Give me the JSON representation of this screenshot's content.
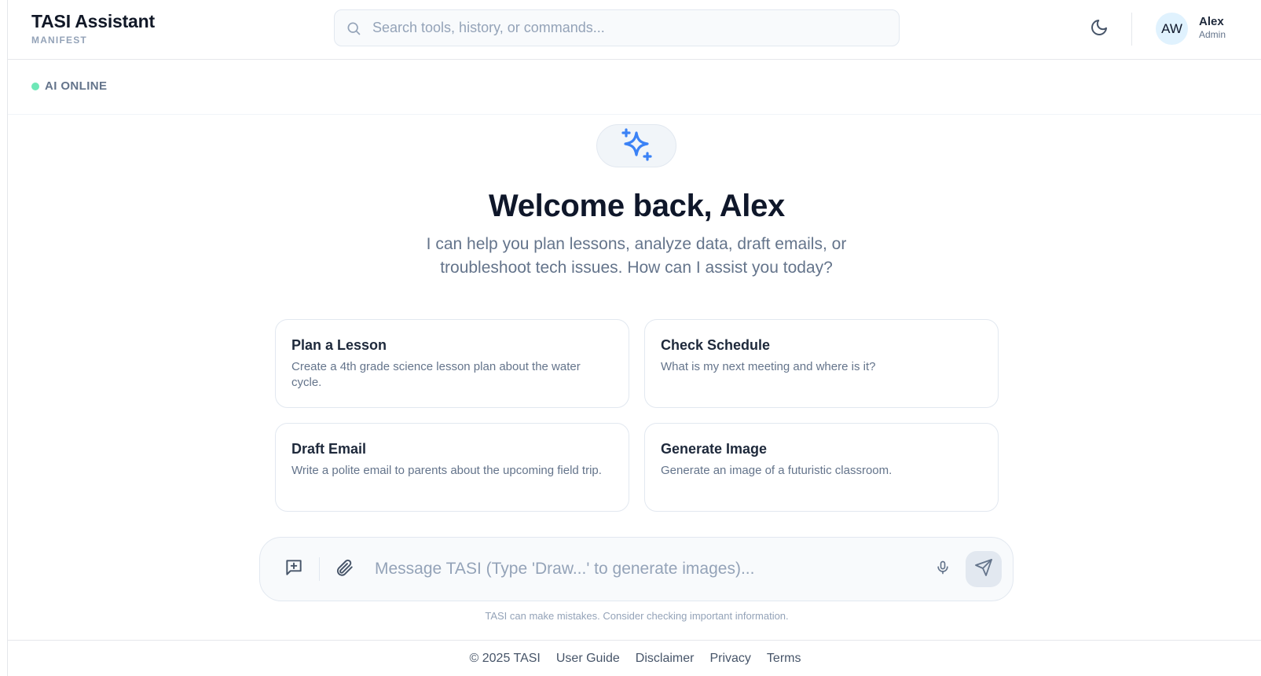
{
  "header": {
    "brand_title": "TASI Assistant",
    "brand_subtitle": "MANIFEST",
    "search_placeholder": "Search tools, history, or commands...",
    "theme_icon": "moon-icon",
    "user": {
      "initials": "AW",
      "name": "Alex",
      "role": "Admin"
    }
  },
  "status": {
    "label": "AI ONLINE",
    "color": "#6ee7b7"
  },
  "hero": {
    "icon": "sparkles-icon",
    "title": "Welcome back, Alex",
    "subtitle": "I can help you plan lessons, analyze data, draft emails, or troubleshoot tech issues. How can I assist you today?"
  },
  "suggestions": [
    {
      "title": "Plan a Lesson",
      "description": "Create a 4th grade science lesson plan about the water cycle."
    },
    {
      "title": "Check Schedule",
      "description": "What is my next meeting and where is it?"
    },
    {
      "title": "Draft Email",
      "description": "Write a polite email to parents about the upcoming field trip."
    },
    {
      "title": "Generate Image",
      "description": "Generate an image of a futuristic classroom."
    }
  ],
  "composer": {
    "placeholder": "Message TASI (Type 'Draw...' to generate images)...",
    "disclaimer": "TASI can make mistakes. Consider checking important information."
  },
  "footer": {
    "copyright": "© 2025 TASI",
    "links": [
      "User Guide",
      "Disclaimer",
      "Privacy",
      "Terms"
    ]
  },
  "colors": {
    "accent": "#3b82f6",
    "text": "#0f172a",
    "muted": "#64748b"
  }
}
